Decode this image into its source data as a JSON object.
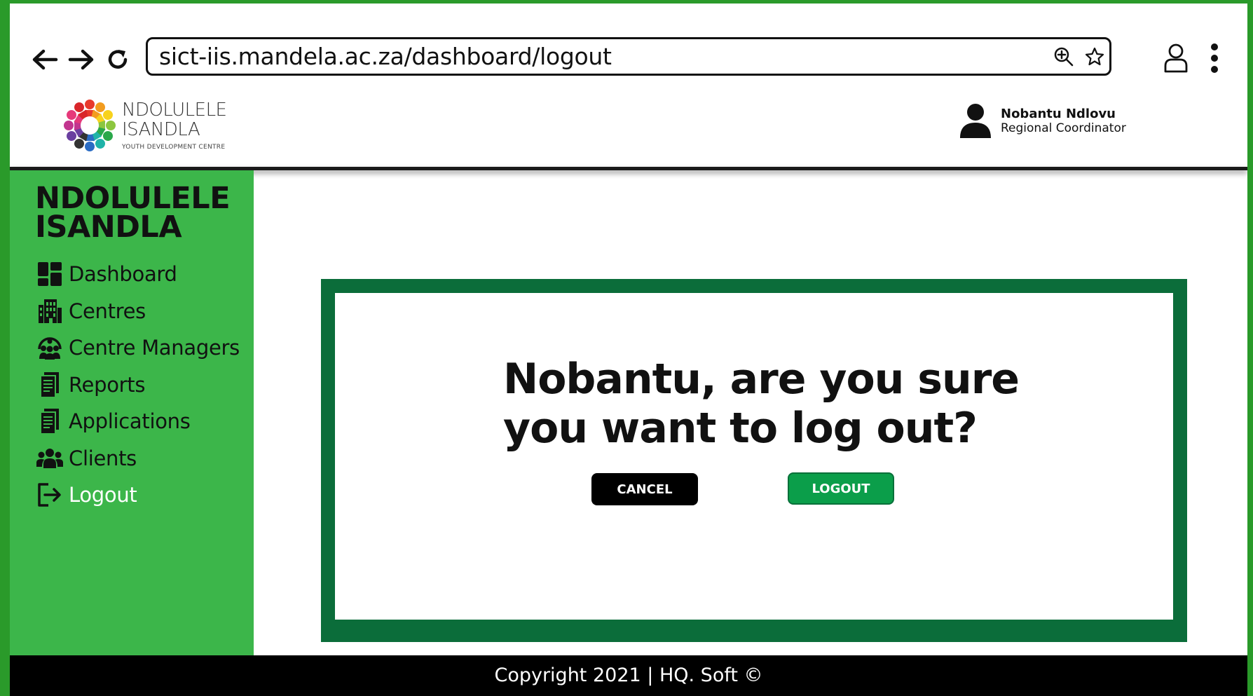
{
  "browser": {
    "url": "sict-iis.mandela.ac.za/dashboard/logout",
    "back_icon": "arrow-left-icon",
    "forward_icon": "arrow-right-icon",
    "reload_icon": "reload-icon",
    "zoom_icon": "zoom-in-icon",
    "bookmark_icon": "star-icon",
    "profile_icon": "user-icon",
    "menu_icon": "kebab-menu-icon"
  },
  "header": {
    "brand_line1": "NDOLULELE",
    "brand_line2": "ISANDLA",
    "brand_sub": "YOUTH DEVELOPMENT CENTRE",
    "user_name": "Nobantu Ndlovu",
    "user_role": "Regional Coordinator"
  },
  "sidebar": {
    "title_line1": "NDOLULELE",
    "title_line2": "ISANDLA",
    "items": [
      {
        "label": "Dashboard",
        "icon": "dashboard-icon"
      },
      {
        "label": "Centres",
        "icon": "building-icon"
      },
      {
        "label": "Centre Managers",
        "icon": "people-arch-icon"
      },
      {
        "label": "Reports",
        "icon": "document-icon"
      },
      {
        "label": "Applications",
        "icon": "document-icon"
      },
      {
        "label": "Clients",
        "icon": "users-icon"
      },
      {
        "label": "Logout",
        "icon": "logout-icon"
      }
    ],
    "active": "Logout"
  },
  "dialog": {
    "message": "Nobantu, are you sure you want to log out?",
    "cancel_label": "CANCEL",
    "logout_label": "LOGOUT"
  },
  "footer": {
    "text": "Copyright 2021 | HQ. Soft ©"
  },
  "colors": {
    "outer_border": "#2a9a2a",
    "sidebar_bg": "#3cb64a",
    "dialog_border": "#0b6d3a",
    "logout_button": "#0b9e4a",
    "cancel_button": "#000000",
    "footer_bg": "#000000"
  }
}
